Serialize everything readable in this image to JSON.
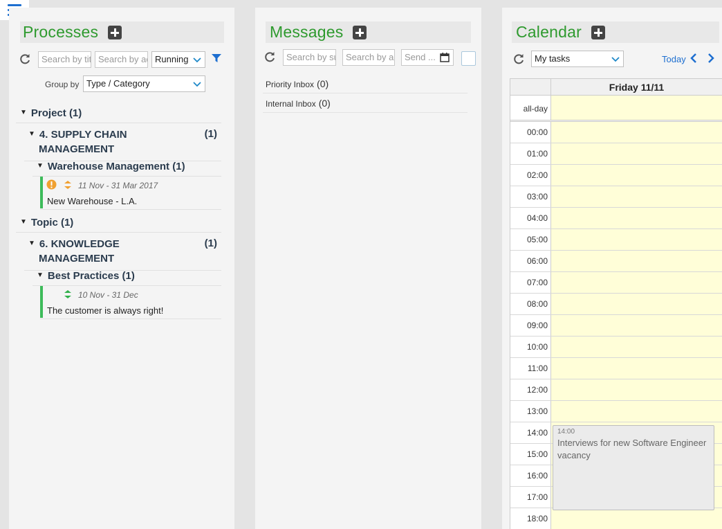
{
  "processes": {
    "title": "Processes",
    "search_title_placeholder": "Search by title",
    "search_actor_placeholder": "Search by actor",
    "status_filter": "Running",
    "group_by_label": "Group by",
    "group_by_value": "Type / Category",
    "groups": [
      {
        "label": "Project",
        "count": "(1)",
        "sub": {
          "label_line1": "4. SUPPLY CHAIN",
          "label_line2": "MANAGEMENT",
          "count": "(1)",
          "category": {
            "label": "Warehouse Management",
            "count": "(1)",
            "item": {
              "dates": "11 Nov  -  31 Mar 2017",
              "name": "New Warehouse - L.A."
            }
          }
        }
      },
      {
        "label": "Topic",
        "count": "(1)",
        "sub": {
          "label_line1": "6. KNOWLEDGE",
          "label_line2": "MANAGEMENT",
          "count": "(1)",
          "category": {
            "label": "Best Practices",
            "count": "(1)",
            "item": {
              "dates": "10 Nov  -  31 Dec",
              "name": "The customer is always right!"
            }
          }
        }
      }
    ]
  },
  "messages": {
    "title": "Messages",
    "search_subject_placeholder": "Search by subject",
    "search_actor_placeholder": "Search by actor",
    "send_date_placeholder": "Send ...",
    "inboxes": [
      {
        "label": "Priority Inbox",
        "count": "(0)"
      },
      {
        "label": "Internal Inbox",
        "count": "(0)"
      }
    ]
  },
  "calendar": {
    "title": "Calendar",
    "filter_value": "My tasks",
    "today_label": "Today",
    "day_header": "Friday 11/11",
    "allday_label": "all-day",
    "hours": [
      "00:00",
      "01:00",
      "02:00",
      "03:00",
      "04:00",
      "05:00",
      "06:00",
      "07:00",
      "08:00",
      "09:00",
      "10:00",
      "11:00",
      "12:00",
      "13:00",
      "14:00",
      "15:00",
      "16:00",
      "17:00",
      "18:00"
    ],
    "event": {
      "time": "14:00",
      "name": "Interviews for new Software Engineer vacancy"
    }
  },
  "colors": {
    "accent_green": "#2e9a2e",
    "link_blue": "#1e6fd0",
    "item_bar": "#3dbb5a",
    "event_bg": "#ebebeb",
    "calendar_cell": "#fffed8"
  }
}
